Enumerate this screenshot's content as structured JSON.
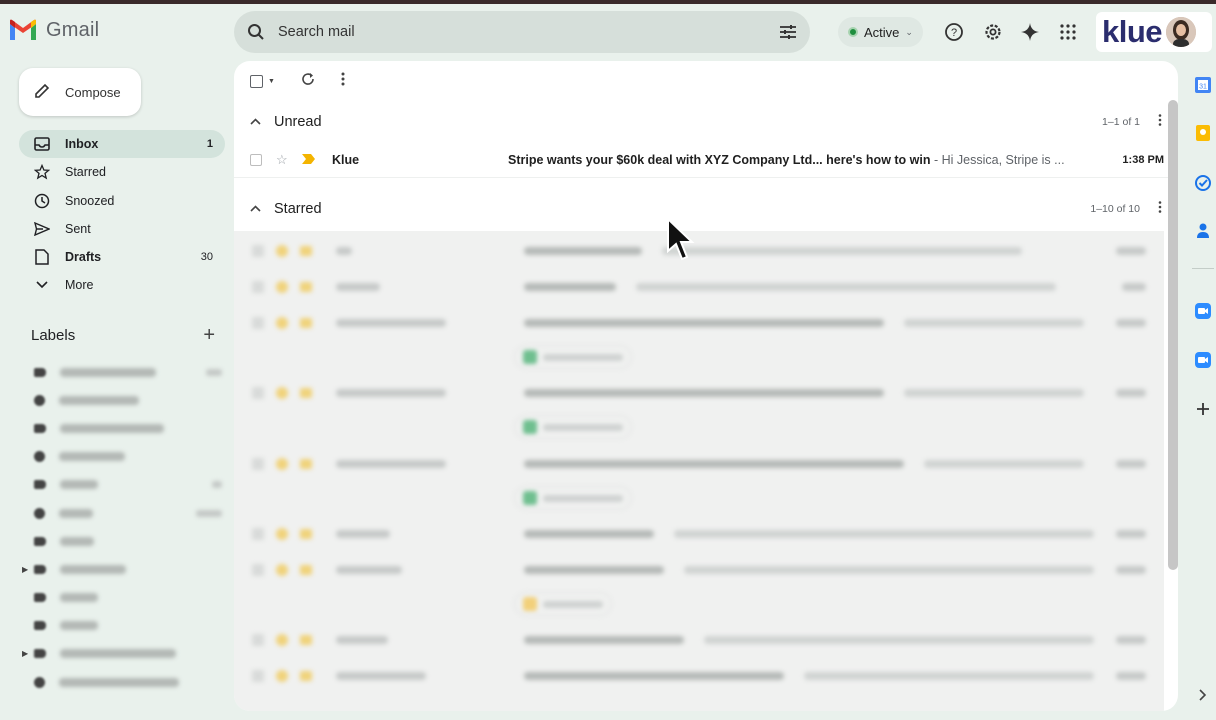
{
  "app": {
    "name": "Gmail"
  },
  "search": {
    "placeholder": "Search mail"
  },
  "status": {
    "label": "Active"
  },
  "brand": {
    "klue_logo_text": "klue"
  },
  "compose": {
    "label": "Compose"
  },
  "nav": {
    "items": [
      {
        "label": "Inbox",
        "count": "1",
        "icon": "inbox-icon"
      },
      {
        "label": "Starred",
        "count": "",
        "icon": "star-icon"
      },
      {
        "label": "Snoozed",
        "count": "",
        "icon": "clock-icon"
      },
      {
        "label": "Sent",
        "count": "",
        "icon": "send-icon"
      },
      {
        "label": "Drafts",
        "count": "30",
        "icon": "draft-icon"
      },
      {
        "label": "More",
        "count": "",
        "icon": "chevron-down-icon"
      }
    ]
  },
  "labels": {
    "title": "Labels"
  },
  "sections": {
    "unread": {
      "title": "Unread",
      "range": "1–1 of 1"
    },
    "starred": {
      "title": "Starred",
      "range": "1–10 of 10"
    }
  },
  "unread_email": {
    "sender": "Klue",
    "subject": "Stripe wants your $60k deal with XYZ Company Ltd... here's how to win",
    "snippet": " - Hi Jessica, Stripe is ...",
    "time": "1:38 PM"
  },
  "colors": {
    "background": "#e9f1ec",
    "panel": "#ffffff",
    "active_nav": "#d3e3dc",
    "status_dot": "#1e8e3e",
    "klue_brand": "#2b2d6e"
  }
}
